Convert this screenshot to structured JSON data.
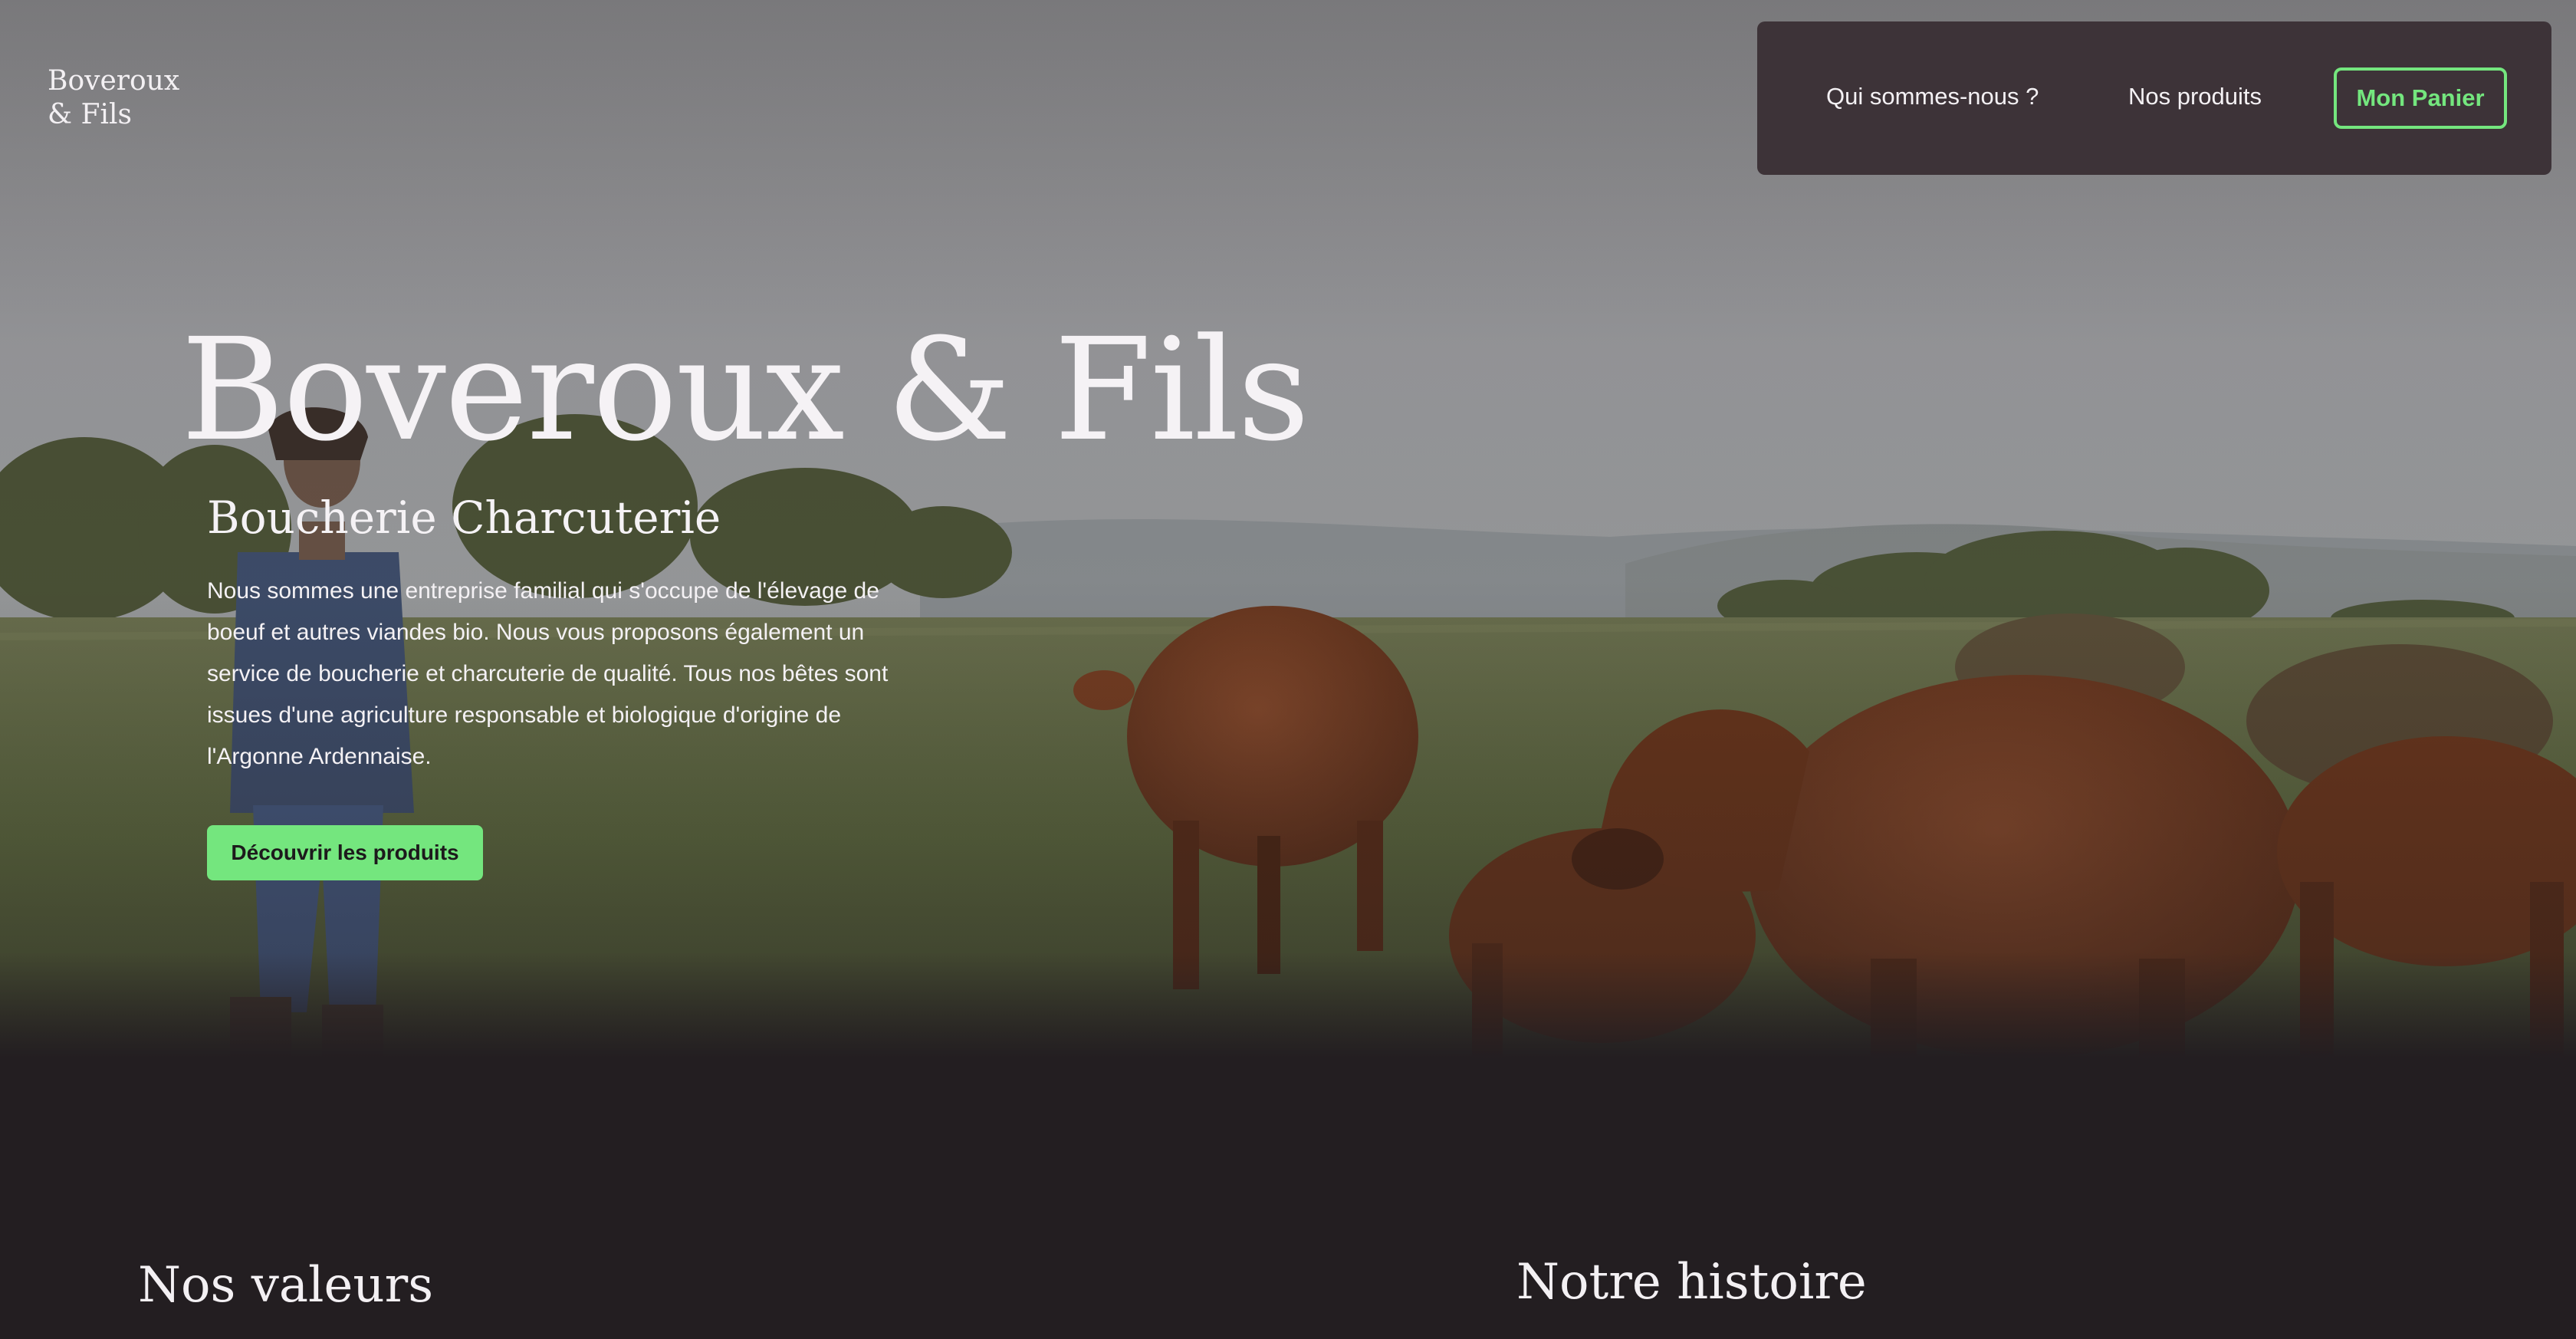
{
  "brand": {
    "line1": "Boveroux",
    "line2": "& Fils"
  },
  "nav": {
    "about_label": "Qui sommes-nous ?",
    "products_label": "Nos produits",
    "cart_label": "Mon Panier"
  },
  "hero": {
    "title": "Boveroux & Fils",
    "subtitle": "Boucherie Charcuterie",
    "description": "Nous sommes une entreprise familial qui s'occupe de l'élevage de boeuf et autres viandes bio. Nous vous proposons également un service de boucherie et charcuterie de qualité. Tous nos bêtes sont issues d'une agriculture responsable et biologique d'origine de l'Argonne Ardennaise.",
    "cta_label": "Découvrir les produits"
  },
  "sections": {
    "values_title": "Nos valeurs",
    "history_title": "Notre histoire"
  },
  "colors": {
    "accent": "#74e67e",
    "nav_background": "#3d3338",
    "page_background": "#231e21"
  }
}
